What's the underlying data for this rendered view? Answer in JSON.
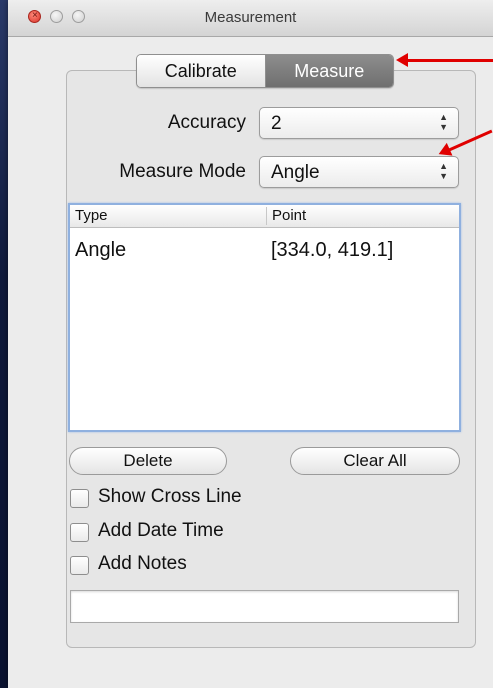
{
  "window": {
    "title": "Measurement"
  },
  "tabs": [
    {
      "label": "Calibrate",
      "selected": false
    },
    {
      "label": "Measure",
      "selected": true
    }
  ],
  "accuracy": {
    "label": "Accuracy",
    "value": "2"
  },
  "measure_mode": {
    "label": "Measure Mode",
    "value": "Angle"
  },
  "table": {
    "columns": [
      "Type",
      "Point"
    ],
    "rows": [
      {
        "type": "Angle",
        "point": "[334.0, 419.1]"
      }
    ]
  },
  "buttons": {
    "delete": "Delete",
    "clear_all": "Clear All"
  },
  "options": [
    {
      "label": "Show Cross Line",
      "checked": false
    },
    {
      "label": "Add Date Time",
      "checked": false
    },
    {
      "label": "Add Notes",
      "checked": false
    }
  ],
  "notes_input": {
    "value": ""
  },
  "colors": {
    "annotation_arrow": "#e00000",
    "selected_tab": "#7a7a7a",
    "table_focus_ring": "#8fb0df"
  },
  "icons": [
    "close-icon",
    "minimize-icon",
    "zoom-icon",
    "up-down-arrows-icon",
    "arrow-annotation-icon"
  ]
}
